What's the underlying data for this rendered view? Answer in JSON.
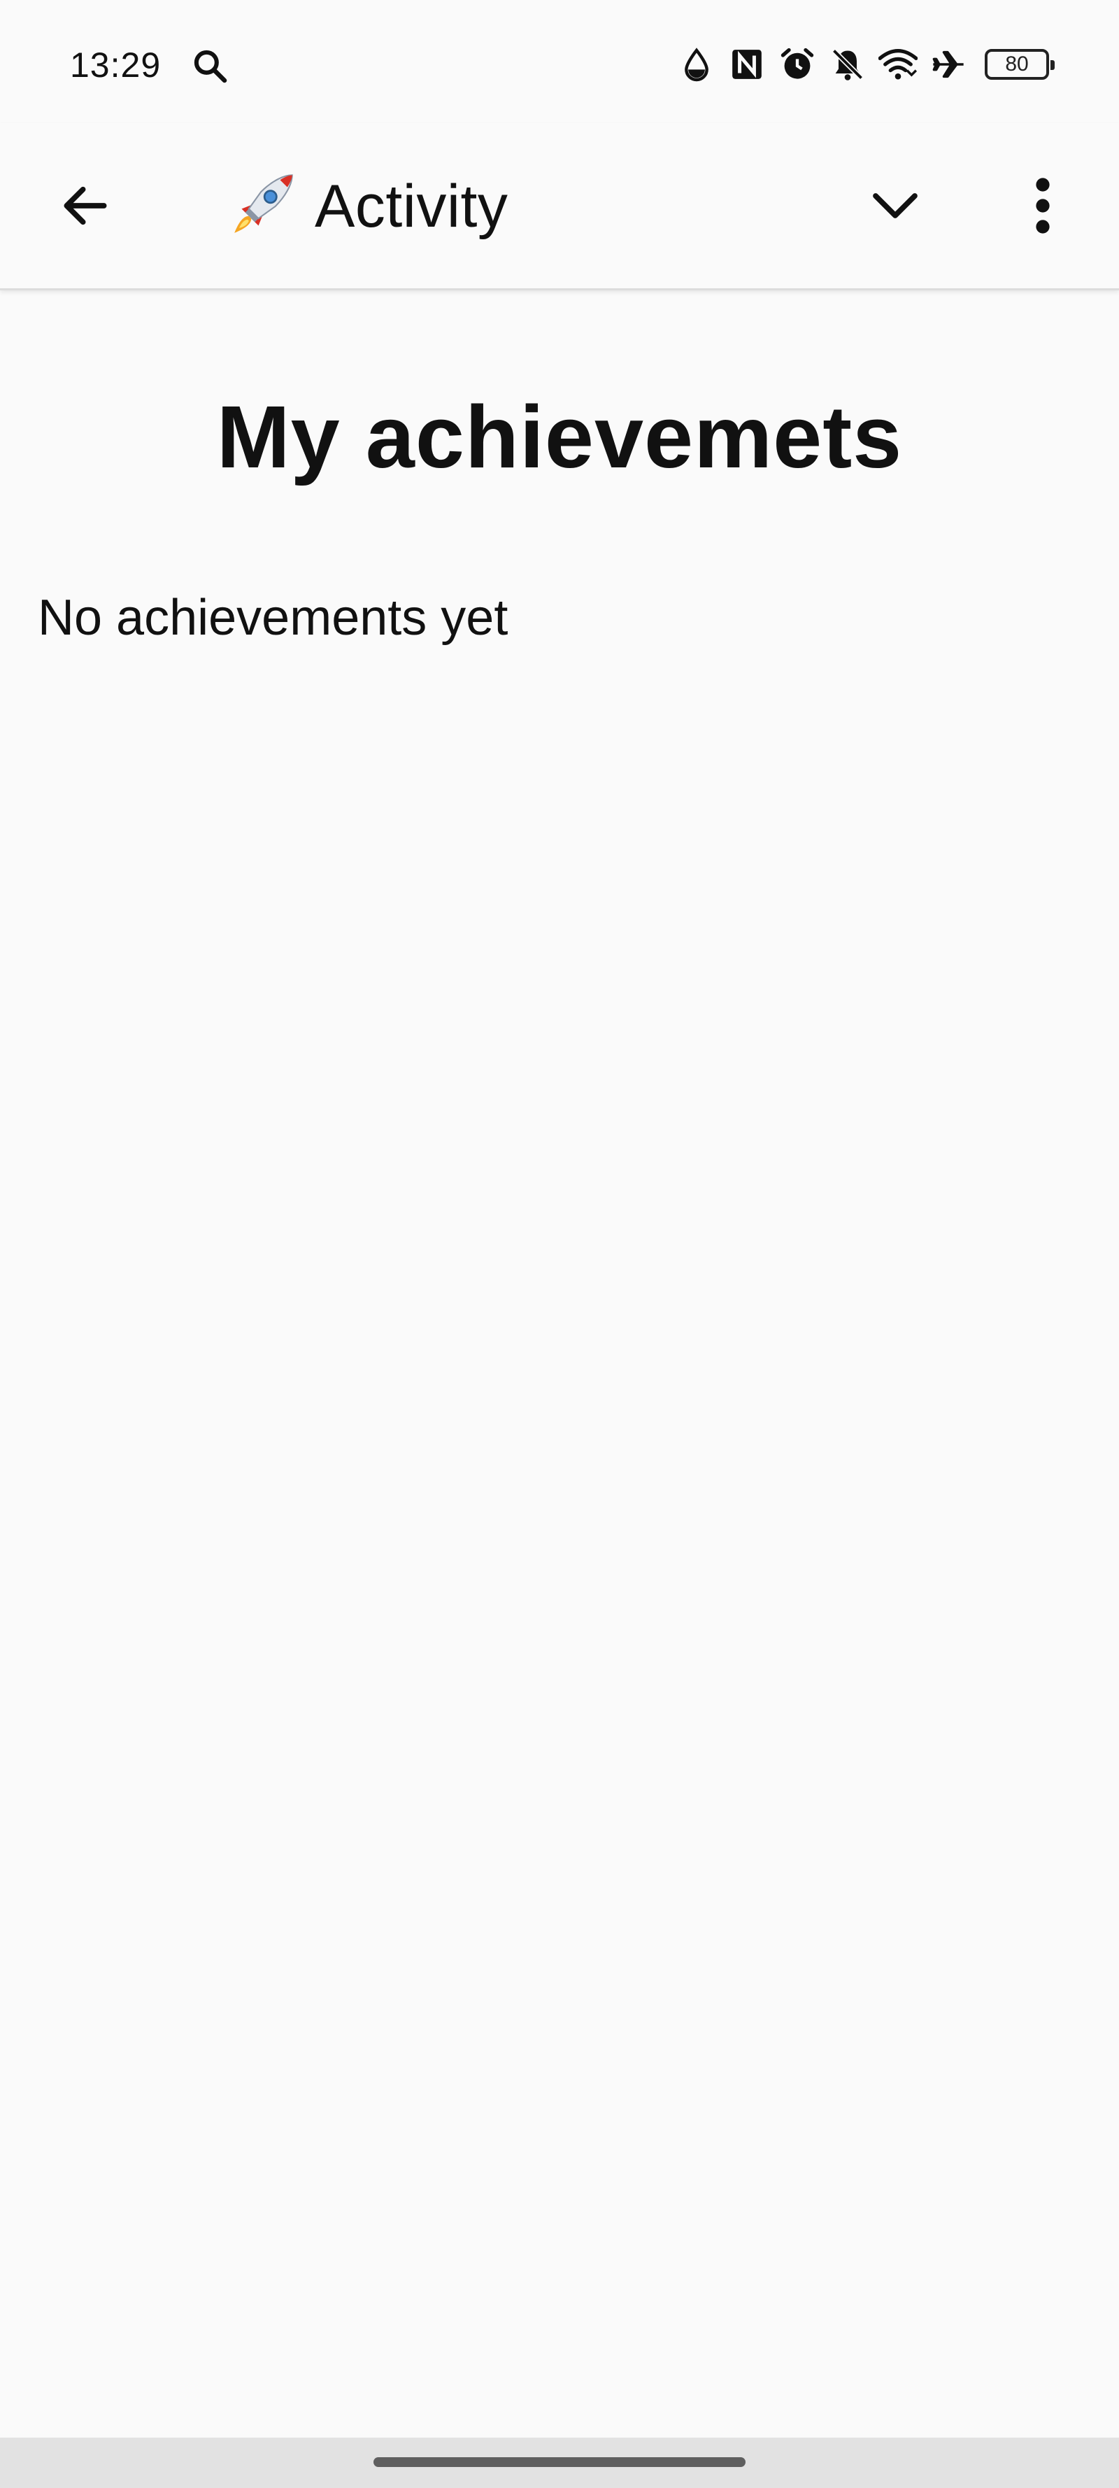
{
  "status_bar": {
    "time": "13:29",
    "battery_level": "80",
    "icons": [
      "search-icon",
      "drop-icon",
      "nfc-icon",
      "alarm-icon",
      "bell-off-icon",
      "wifi-icon",
      "airplane-icon",
      "battery-icon"
    ]
  },
  "app_bar": {
    "title_emoji": "rocket-icon",
    "title": "Activity",
    "back_icon": "arrow-left-icon",
    "dropdown_icon": "chevron-down-icon",
    "menu_icon": "more-vert-icon"
  },
  "main": {
    "heading": "My achievemets",
    "empty_message": "No achievements yet"
  },
  "colors": {
    "background": "#fafafa",
    "text": "#111111",
    "divider": "#dcdcdc",
    "nav_bar": "#e2e2e2"
  }
}
